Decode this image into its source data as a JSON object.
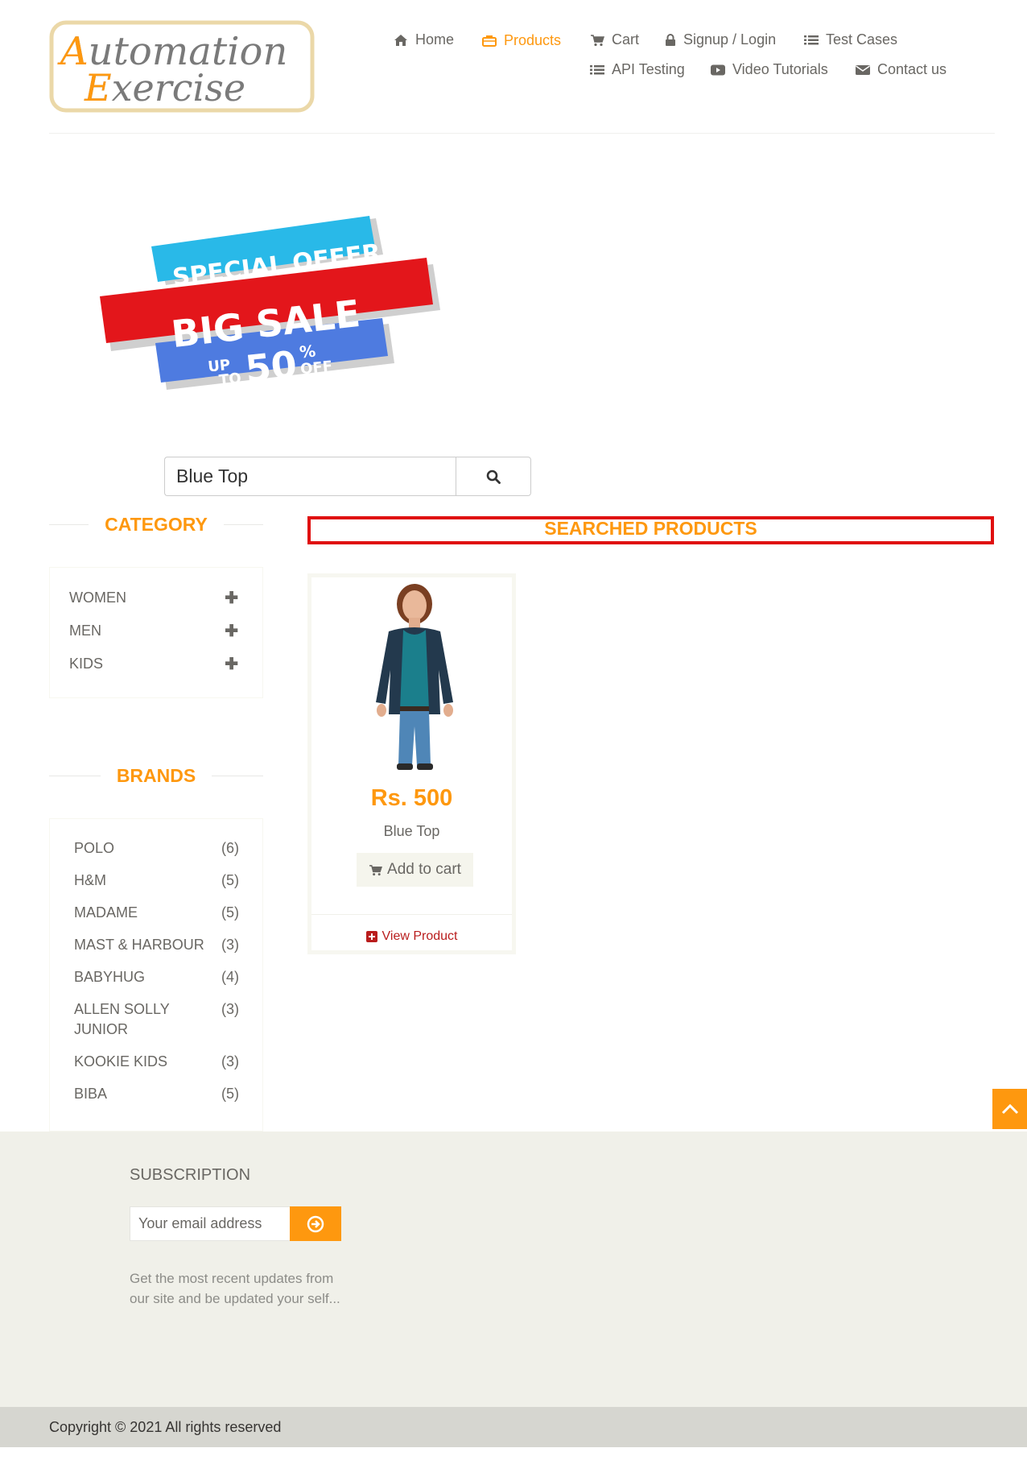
{
  "brand": {
    "logo_line1": "Automation",
    "logo_line2": "Exercise"
  },
  "nav": {
    "home": "Home",
    "products": "Products",
    "cart": "Cart",
    "signup": "Signup / Login",
    "test_cases": "Test Cases",
    "api_testing": "API Testing",
    "video_tutorials": "Video Tutorials",
    "contact_us": "Contact us"
  },
  "banner": {
    "line1": "SPECIAL OFFER",
    "line2": "BIG SALE",
    "up": "UP",
    "to": "TO",
    "number": "50",
    "percent": "%",
    "off": "OFF"
  },
  "search": {
    "value": "Blue Top"
  },
  "category": {
    "title": "CATEGORY",
    "items": [
      {
        "label": "WOMEN"
      },
      {
        "label": "MEN"
      },
      {
        "label": "KIDS"
      }
    ]
  },
  "brands": {
    "title": "BRANDS",
    "items": [
      {
        "name": "POLO",
        "count": "(6)"
      },
      {
        "name": "H&M",
        "count": "(5)"
      },
      {
        "name": "MADAME",
        "count": "(5)"
      },
      {
        "name": "MAST & HARBOUR",
        "count": "(3)"
      },
      {
        "name": "BABYHUG",
        "count": "(4)"
      },
      {
        "name": "ALLEN SOLLY JUNIOR",
        "count": "(3)"
      },
      {
        "name": "KOOKIE KIDS",
        "count": "(3)"
      },
      {
        "name": "BIBA",
        "count": "(5)"
      }
    ]
  },
  "results": {
    "title": "SEARCHED PRODUCTS",
    "products": [
      {
        "price": "Rs. 500",
        "name": "Blue Top",
        "add_to_cart": "Add to cart",
        "view_product": "View Product"
      }
    ]
  },
  "footer": {
    "subscription_title": "SUBSCRIPTION",
    "email_placeholder": "Your email address",
    "subscription_text": "Get the most recent updates from our site and be updated your self...",
    "copyright": "Copyright © 2021 All rights reserved"
  },
  "colors": {
    "accent": "#FE980F",
    "link_red": "#B91D1D",
    "footer_bg": "#F0F0E9",
    "highlight_border": "#e01010"
  }
}
